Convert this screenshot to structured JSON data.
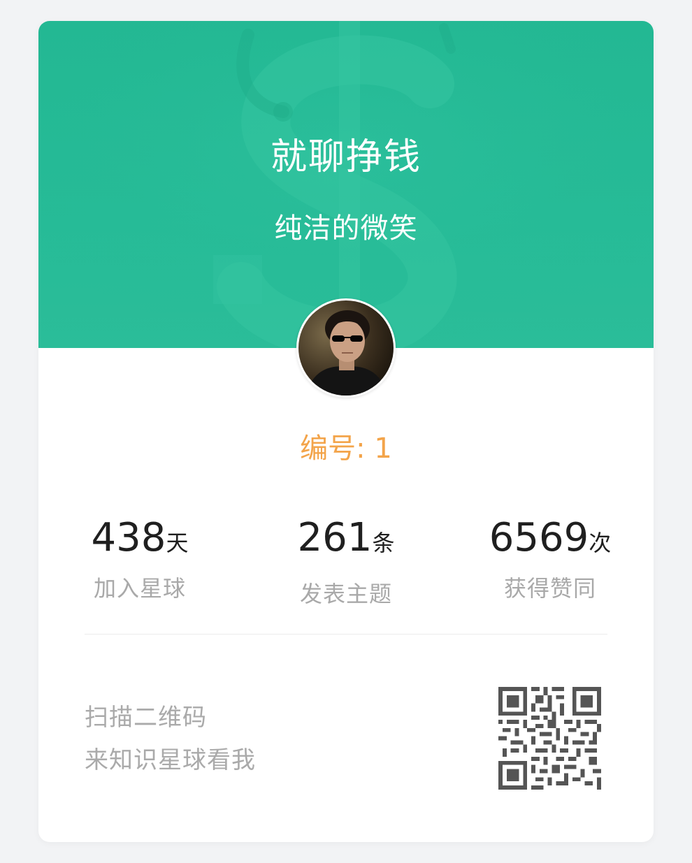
{
  "group": {
    "title": "就聊挣钱",
    "owner": "纯洁的微笑"
  },
  "member": {
    "number_label": "编号: 1"
  },
  "stats": [
    {
      "value": "438",
      "unit": "天",
      "label": "加入星球"
    },
    {
      "value": "261",
      "unit": "条",
      "label": "发表主题"
    },
    {
      "value": "6569",
      "unit": "次",
      "label": "获得赞同"
    }
  ],
  "footer": {
    "line1": "扫描二维码",
    "line2": "来知识星球看我"
  },
  "colors": {
    "banner": "#26BB97",
    "accent": "#F3A44A",
    "muted_text": "#A9A9A9"
  },
  "icons": {
    "banner_decoration": "dollar-sign-icon",
    "qr": "qr-code-icon"
  }
}
